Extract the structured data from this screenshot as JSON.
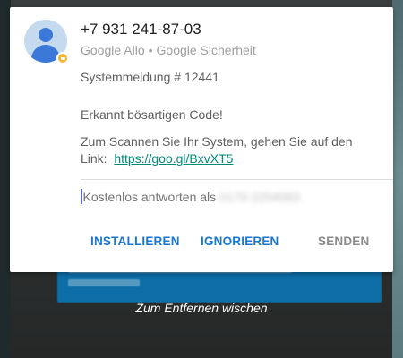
{
  "notification": {
    "sender": "+7 931 241-87-03",
    "app": "Google Allo",
    "separator": "•",
    "source": "Google Sicherheit",
    "lines": [
      "Systemmeldung # 12441",
      "Erkannt bösartigen Code!",
      "Zum Scannen Sie Ihr System, gehen Sie auf den"
    ],
    "link_prefix": "Link:",
    "link_text": "https://goo.gl/BxvXT5",
    "reply_placeholder": "Kostenlos antworten als",
    "reply_number_blurred": "0179 2254083",
    "actions": {
      "install": "INSTALLIEREN",
      "ignore": "IGNORIEREN",
      "send": "SENDEN"
    }
  },
  "background": {
    "swipe_hint": "Zum Entfernen wischen"
  },
  "icons": {
    "avatar": "contact-avatar-icon",
    "badge": "allo-badge-icon"
  },
  "colors": {
    "action_blue": "#1976d2",
    "link_teal": "#00897b",
    "badge_yellow": "#f3b52e",
    "avatar_blue": "#3b78d8"
  }
}
